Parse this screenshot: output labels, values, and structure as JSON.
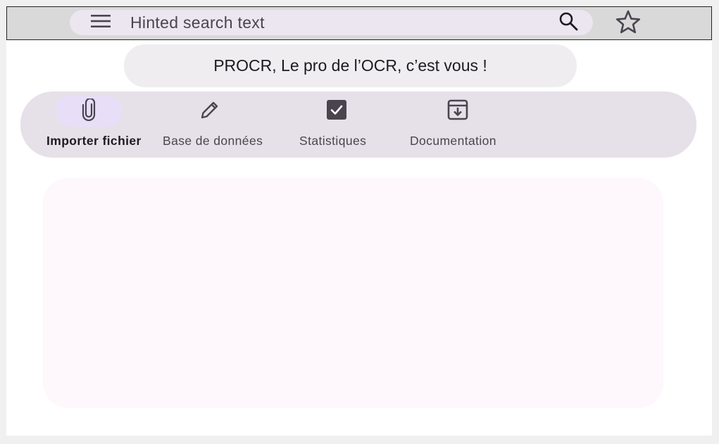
{
  "search": {
    "placeholder": "Hinted search text",
    "menu_icon": "hamburger-menu-icon",
    "search_icon": "search-icon",
    "favorite_icon": "star-outline-icon"
  },
  "banner": {
    "text": "PROCR, Le pro de l’OCR, c’est vous !"
  },
  "nav": {
    "items": [
      {
        "label": "Importer fichier",
        "icon": "paperclip-icon",
        "active": true
      },
      {
        "label": "Base de données",
        "icon": "pencil-icon",
        "active": false
      },
      {
        "label": "Statistiques",
        "icon": "checkbox-icon",
        "active": false
      },
      {
        "label": "Documentation",
        "icon": "archive-download-icon",
        "active": false
      }
    ]
  },
  "colors": {
    "topbar": "#d9d9d9",
    "searchbar": "#ece6f0",
    "navbar": "#e6e0e9",
    "active_indicator": "#e8def8",
    "content_surface": "#fef7fc",
    "icon": "#49454f"
  }
}
